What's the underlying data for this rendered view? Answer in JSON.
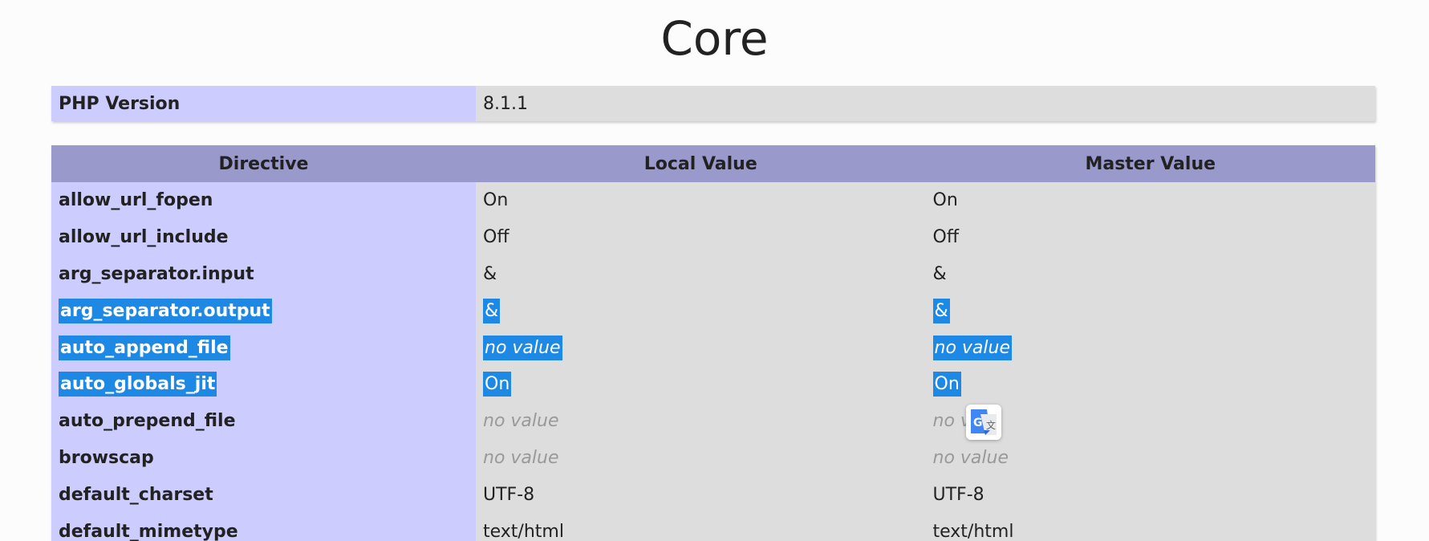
{
  "page": {
    "title": "Core"
  },
  "version_row": {
    "label": "PHP Version",
    "value": "8.1.1"
  },
  "table": {
    "headers": [
      "Directive",
      "Local Value",
      "Master Value"
    ],
    "rows": [
      {
        "directive": "allow_url_fopen",
        "local": "On",
        "master": "On"
      },
      {
        "directive": "allow_url_include",
        "local": "Off",
        "master": "Off"
      },
      {
        "directive": "arg_separator.input",
        "local": "&",
        "master": "&"
      },
      {
        "directive": "arg_separator.output",
        "local": "&",
        "master": "&"
      },
      {
        "directive": "auto_append_file",
        "local": "no value",
        "master": "no value"
      },
      {
        "directive": "auto_globals_jit",
        "local": "On",
        "master": "On"
      },
      {
        "directive": "auto_prepend_file",
        "local": "no value",
        "master": "no v"
      },
      {
        "directive": "browscap",
        "local": "no value",
        "master": "no value"
      },
      {
        "directive": "default_charset",
        "local": "UTF-8",
        "master": "UTF-8"
      },
      {
        "directive": "default_mimetype",
        "local": "text/html",
        "master": "text/html"
      }
    ]
  },
  "colors": {
    "header_bg": "#9999cc",
    "directive_bg": "#ccccff",
    "value_bg": "#dddddd",
    "selection": "#1e88e5",
    "no_value_text": "#999999"
  },
  "icons": {
    "translate": "google-translate-icon"
  }
}
